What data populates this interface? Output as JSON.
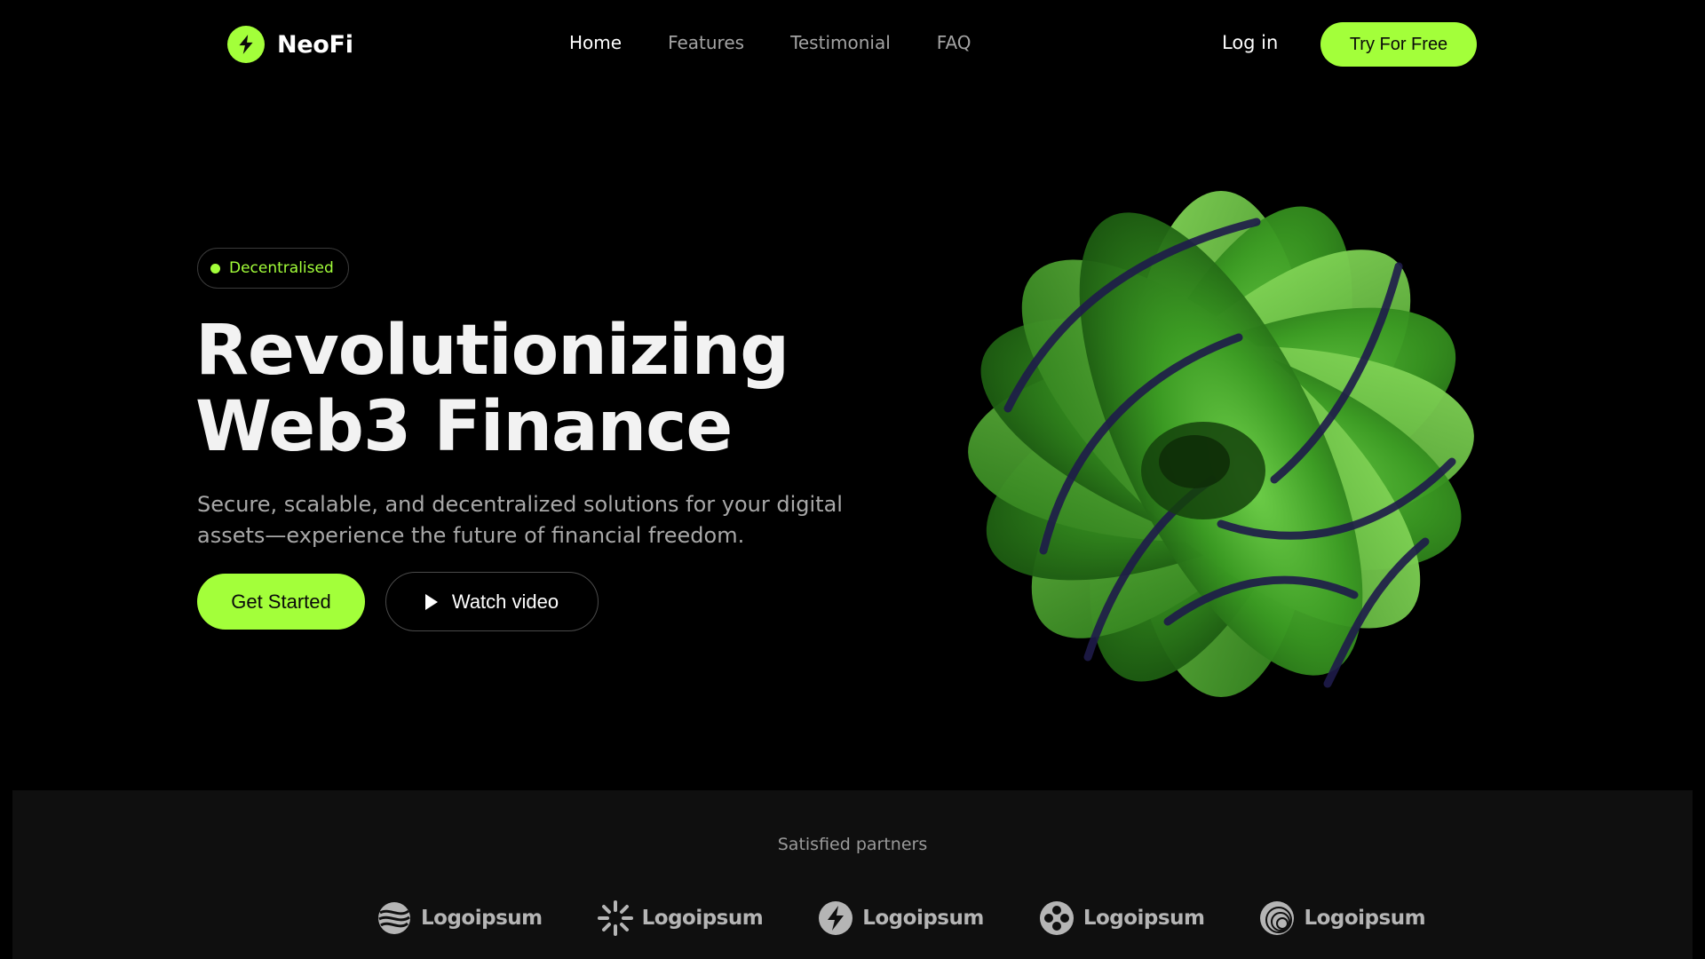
{
  "brand": {
    "name": "NeoFi",
    "accent": "#a3ff3a"
  },
  "nav": {
    "links": [
      {
        "label": "Home",
        "active": true
      },
      {
        "label": "Features",
        "active": false
      },
      {
        "label": "Testimonial",
        "active": false
      },
      {
        "label": "FAQ",
        "active": false
      }
    ],
    "login_label": "Log in",
    "cta_label": "Try For Free"
  },
  "hero": {
    "badge": "Decentralised",
    "title_line1": "Revolutionizing",
    "title_line2": "Web3 Finance",
    "subtitle": "Secure, scalable, and decentralized solutions for your digital assets—experience the future of financial freedom.",
    "primary_button": "Get Started",
    "secondary_button": "Watch video",
    "art_icon": "green-3d-swirl-sphere"
  },
  "partners": {
    "title": "Satisfied partners",
    "logos": [
      {
        "name": "Logoipsum",
        "icon": "wave-globe-icon"
      },
      {
        "name": "Logoipsum",
        "icon": "sunburst-icon"
      },
      {
        "name": "Logoipsum",
        "icon": "bolt-icon"
      },
      {
        "name": "Logoipsum",
        "icon": "four-dots-icon"
      },
      {
        "name": "Logoipsum",
        "icon": "ring-sphere-icon"
      }
    ]
  }
}
